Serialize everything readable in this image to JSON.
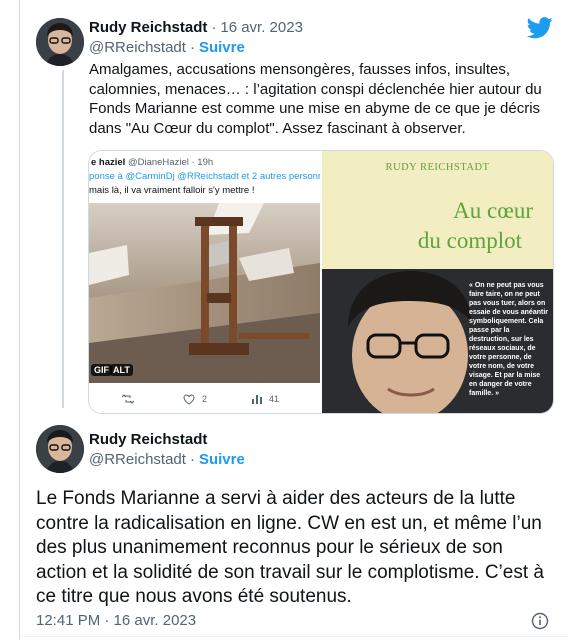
{
  "tweet1": {
    "author_name": "Rudy Reichstadt",
    "date": "16 avr. 2023",
    "handle": "@RReichstadt",
    "follow_label": "Suivre",
    "body": "Amalgames, accusations mensongères, fausses infos, insultes, calomnies, menaces… : l’agitation conspi déclenchée hier autour du Fonds Marianne est comme une mise en abyme de ce que je décris dans \"Au Cœur du complot\". Assez fascinant à observer.",
    "embedded": {
      "header_name": "e haziel",
      "header_handle": "@DianeHaziel",
      "header_time": "19h",
      "reply_line": "ponse à @CarminDj @RReichstadt  et 2 autres personn",
      "text": "mais là, il va vraiment falloir s'y mettre !",
      "gif_badge": "GIF",
      "alt_badge": "ALT",
      "like_count": "2",
      "view_count": "41"
    },
    "book": {
      "author": "RUDY REICHSTADT",
      "title_line1": "Au cœur",
      "title_line2": "du complot",
      "quote": "« On ne peut pas vous faire taire, on ne peut pas vous tuer, alors on essaie de vous anéantir symboliquement. Cela passe par la destruction, sur les réseaux sociaux, de votre personne, de votre nom, de votre visage. Et par la mise en danger de votre famille. »"
    }
  },
  "tweet2": {
    "author_name": "Rudy Reichstadt",
    "handle": "@RReichstadt",
    "follow_label": "Suivre",
    "body": "Le Fonds Marianne a servi à aider des acteurs de la lutte contre la radicalisation en ligne. CW en est un, et même l’un des plus unanimement reconnus pour le sérieux de son action et la solidité de son travail sur le complotisme. C’est à ce titre que nous avons été soutenus.",
    "timestamp": "12:41 PM · 16 avr. 2023"
  },
  "colors": {
    "brand_blue": "#1d9bf0",
    "text_primary": "#0f1419",
    "text_muted": "#536471",
    "border": "#cfd9de",
    "book_cover_yellow": "#f2eec1",
    "book_title_green": "#5fa33a"
  },
  "icons": [
    "twitter-bird-icon",
    "retweet-icon",
    "heart-icon",
    "views-icon",
    "info-icon"
  ]
}
